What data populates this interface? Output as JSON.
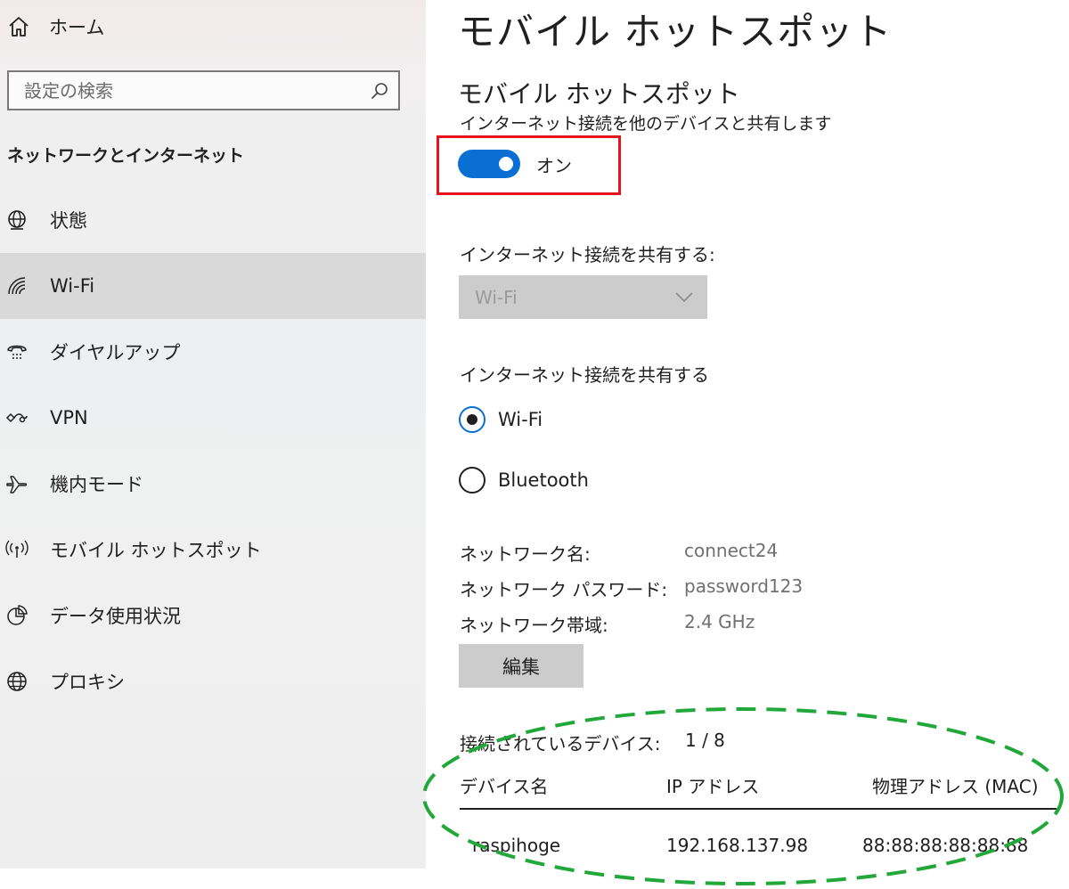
{
  "sidebar": {
    "home_label": "ホーム",
    "search_placeholder": "設定の検索",
    "section_title": "ネットワークとインターネット",
    "items": [
      {
        "label": "状態",
        "icon": "globe-status-icon"
      },
      {
        "label": "Wi-Fi",
        "icon": "wifi-icon",
        "selected": true
      },
      {
        "label": "ダイヤルアップ",
        "icon": "dialup-icon"
      },
      {
        "label": "VPN",
        "icon": "vpn-icon"
      },
      {
        "label": "機内モード",
        "icon": "airplane-icon"
      },
      {
        "label": "モバイル ホットスポット",
        "icon": "hotspot-icon"
      },
      {
        "label": "データ使用状況",
        "icon": "data-usage-icon"
      },
      {
        "label": "プロキシ",
        "icon": "globe-icon"
      }
    ]
  },
  "main": {
    "page_title": "モバイル ホットスポット",
    "subsection_title": "モバイル ホットスポット",
    "description": "インターネット接続を他のデバイスと共有します",
    "toggle_state": "オン",
    "share_from_label": "インターネット接続を共有する:",
    "share_from_value": "Wi-Fi",
    "share_over_label": "インターネット接続を共有する",
    "share_over_options": [
      "Wi-Fi",
      "Bluetooth"
    ],
    "share_over_selected": "Wi-Fi",
    "network_name_label": "ネットワーク名:",
    "network_name_value": "connect24",
    "network_password_label": "ネットワーク パスワード:",
    "network_password_value": "password123",
    "network_band_label": "ネットワーク帯域:",
    "network_band_value": "2.4 GHz",
    "edit_label": "編集",
    "connected_label": "接続されているデバイス:",
    "connected_count": "1 / 8",
    "table": {
      "columns": [
        "デバイス名",
        "IP アドレス",
        "物理アドレス (MAC)"
      ],
      "rows": [
        [
          "raspihoge",
          "192.168.137.98",
          "88:88:88:88:88:88"
        ]
      ]
    }
  },
  "colors": {
    "accent": "#0a6fd3",
    "highlight_box": "#e8141b",
    "annotation_ellipse": "#22a83a"
  }
}
